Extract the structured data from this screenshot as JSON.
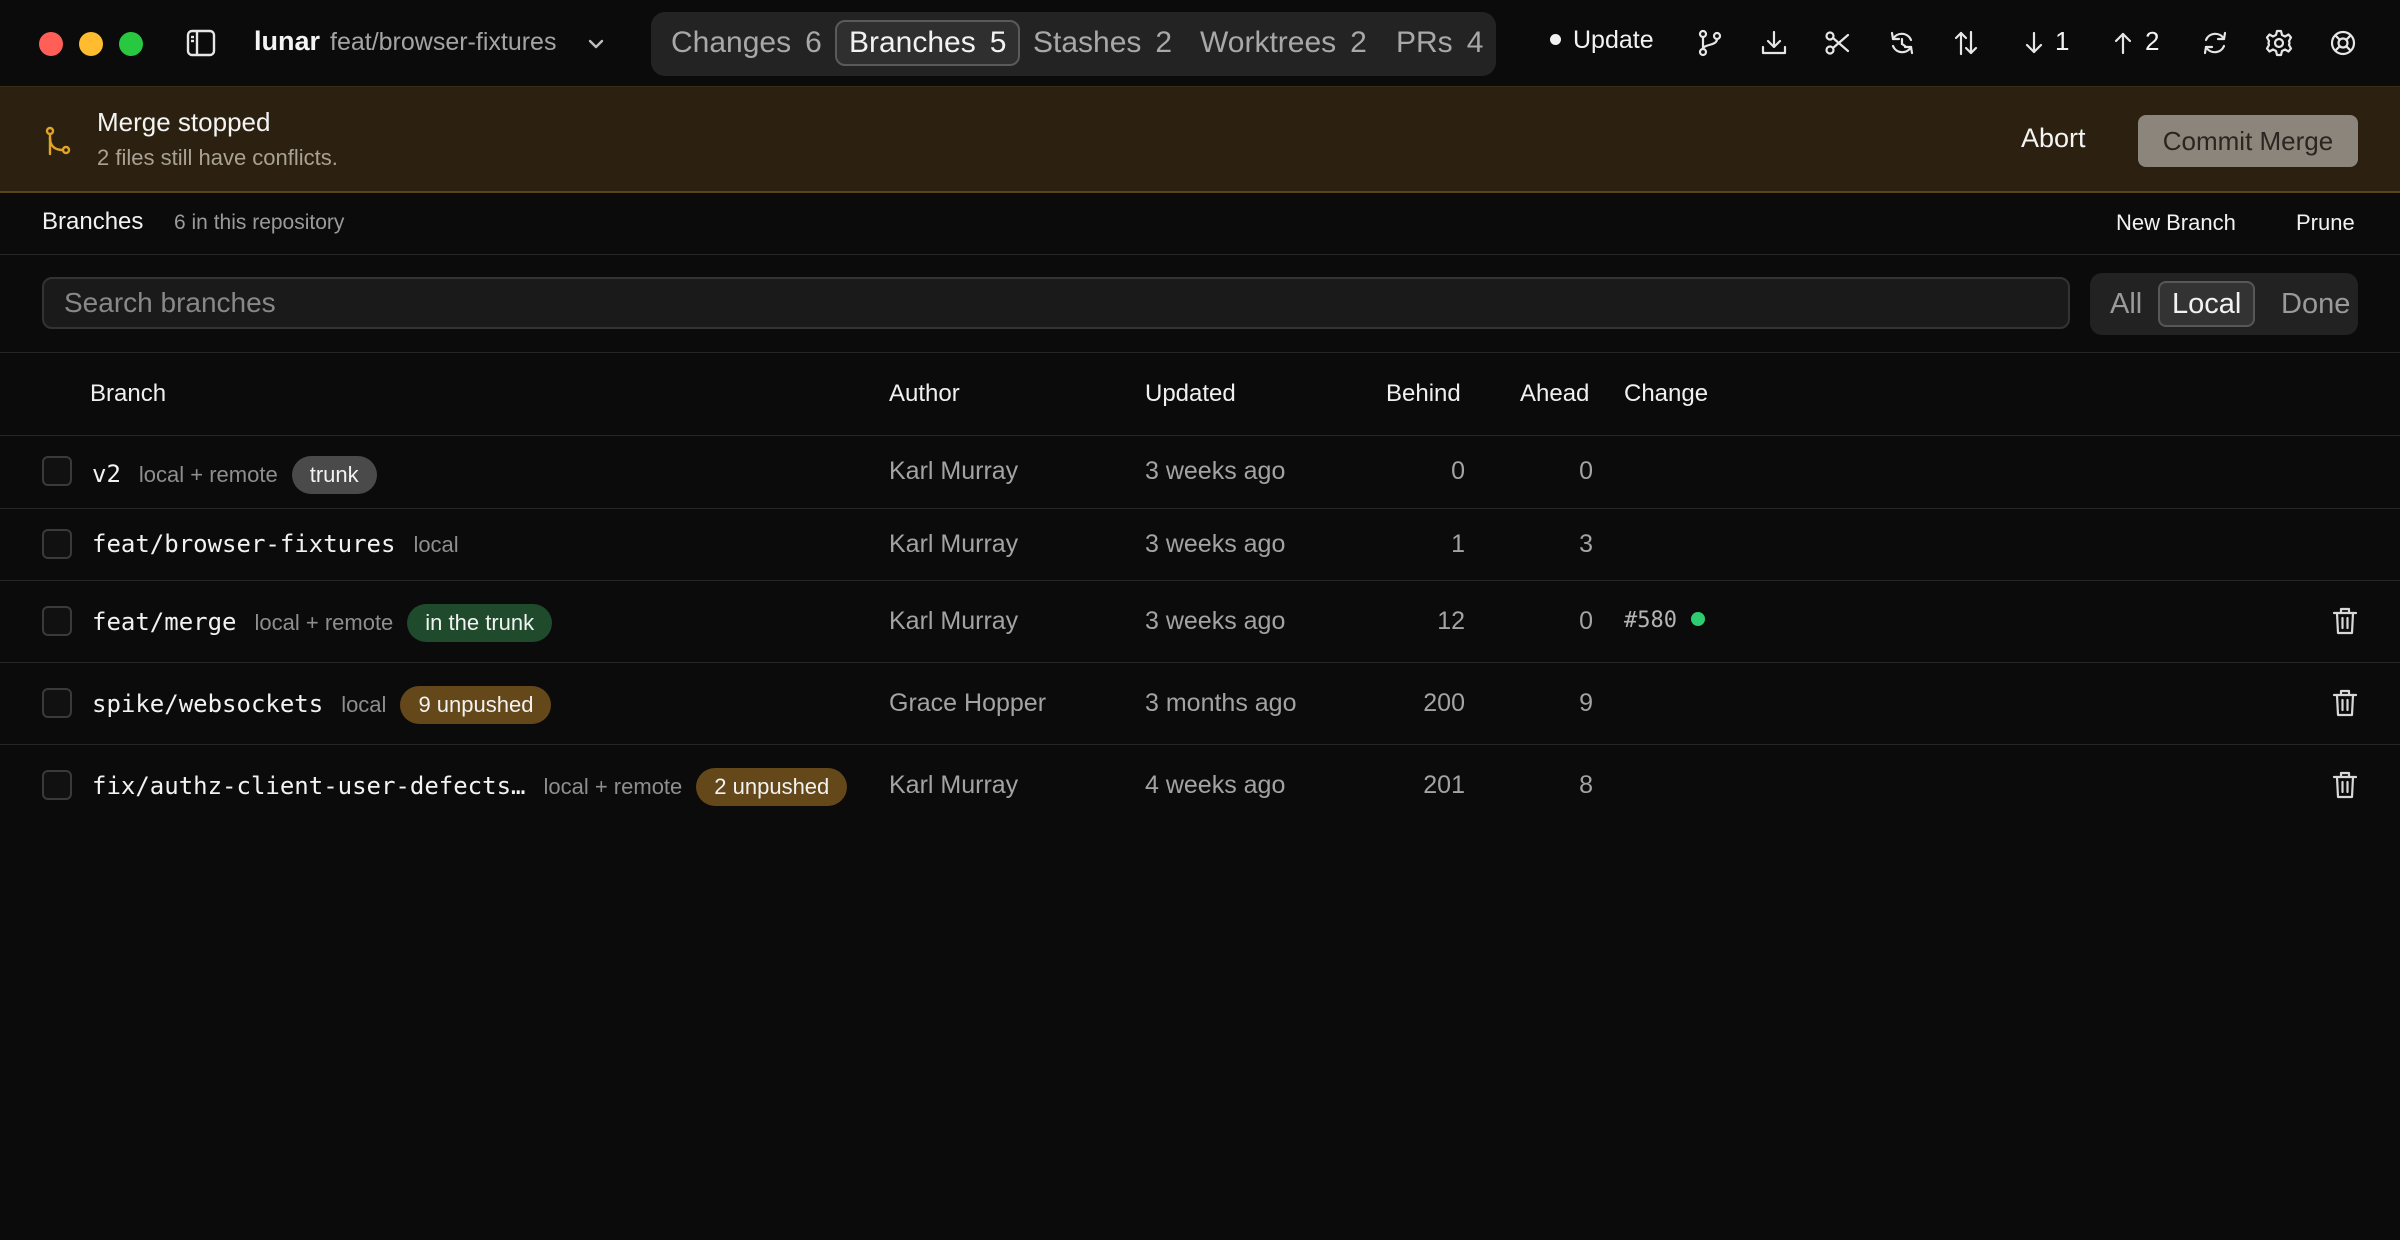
{
  "titlebar": {
    "repo": "lunar",
    "branch": "feat/browser-fixtures",
    "tabs": [
      {
        "label": "Changes",
        "count": "6"
      },
      {
        "label": "Branches",
        "count": "5"
      },
      {
        "label": "Stashes",
        "count": "2"
      },
      {
        "label": "Worktrees",
        "count": "2"
      },
      {
        "label": "PRs",
        "count": "4"
      }
    ],
    "update_label": "Update",
    "pull_count": "1",
    "push_count": "2"
  },
  "banner": {
    "title": "Merge stopped",
    "subtitle": "2 files still have conflicts.",
    "abort_label": "Abort",
    "commit_label": "Commit Merge"
  },
  "section": {
    "title": "Branches",
    "count_text": "6 in this repository",
    "new_branch_label": "New Branch",
    "prune_label": "Prune"
  },
  "search": {
    "placeholder": "Search branches",
    "filters": [
      "All",
      "Local",
      "Done"
    ],
    "active_filter": "Local"
  },
  "table": {
    "headers": {
      "branch": "Branch",
      "author": "Author",
      "updated": "Updated",
      "behind": "Behind",
      "ahead": "Ahead",
      "change": "Change"
    },
    "rows": [
      {
        "name": "v2",
        "location": "local + remote",
        "badge": "trunk",
        "badge_kind": "trunk",
        "author": "Karl Murray",
        "updated": "3 weeks ago",
        "behind": "0",
        "ahead": "0",
        "change": "",
        "deletable": false
      },
      {
        "name": "feat/browser-fixtures",
        "location": "local",
        "badge": "",
        "badge_kind": "",
        "author": "Karl Murray",
        "updated": "3 weeks ago",
        "behind": "1",
        "ahead": "3",
        "change": "",
        "deletable": false
      },
      {
        "name": "feat/merge",
        "location": "local + remote",
        "badge": "in the trunk",
        "badge_kind": "in",
        "author": "Karl Murray",
        "updated": "3 weeks ago",
        "behind": "12",
        "ahead": "0",
        "change": "#580",
        "deletable": true
      },
      {
        "name": "spike/websockets",
        "location": "local",
        "badge": "9 unpushed",
        "badge_kind": "unp",
        "author": "Grace Hopper",
        "updated": "3 months ago",
        "behind": "200",
        "ahead": "9",
        "change": "",
        "deletable": true
      },
      {
        "name": "fix/authz-client-user-defects…",
        "location": "local + remote",
        "badge": "2 unpushed",
        "badge_kind": "unp",
        "author": "Karl Murray",
        "updated": "4 weeks ago",
        "behind": "201",
        "ahead": "8",
        "change": "",
        "deletable": true
      }
    ]
  },
  "colors": {
    "banner_bg": "#2c2110",
    "banner_icon": "#e0a526",
    "change_status": "#2ecc71",
    "badge_in_trunk": "#1f4a2b",
    "badge_unpushed": "#65481a"
  }
}
